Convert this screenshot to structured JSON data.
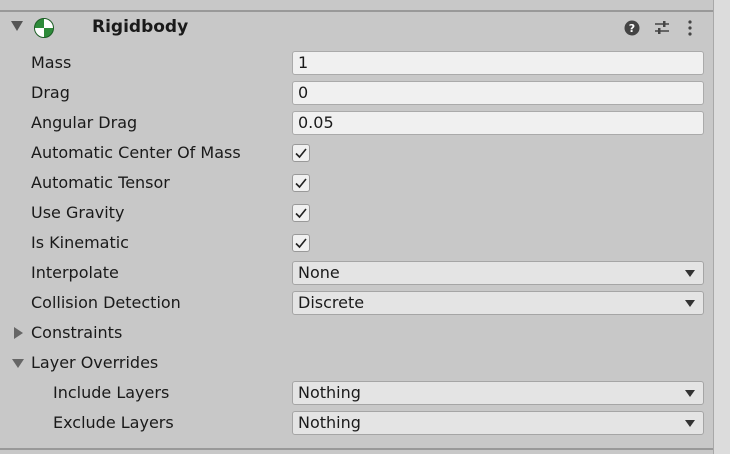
{
  "component": {
    "title": "Rigidbody",
    "icon": "rigidbody-icon",
    "tools": [
      "help-icon",
      "presets-icon",
      "more-options-icon"
    ]
  },
  "fields": {
    "mass": {
      "label": "Mass",
      "value": "1"
    },
    "drag": {
      "label": "Drag",
      "value": "0"
    },
    "angular_drag": {
      "label": "Angular Drag",
      "value": "0.05"
    },
    "automatic_center_of_mass": {
      "label": "Automatic Center Of Mass",
      "checked": true
    },
    "automatic_tensor": {
      "label": "Automatic Tensor",
      "checked": true
    },
    "use_gravity": {
      "label": "Use Gravity",
      "checked": true
    },
    "is_kinematic": {
      "label": "Is Kinematic",
      "checked": true
    },
    "interpolate": {
      "label": "Interpolate",
      "value": "None"
    },
    "collision_detection": {
      "label": "Collision Detection",
      "value": "Discrete"
    },
    "constraints": {
      "label": "Constraints",
      "expanded": false
    },
    "layer_overrides": {
      "label": "Layer Overrides",
      "expanded": true,
      "include_layers": {
        "label": "Include Layers",
        "value": "Nothing"
      },
      "exclude_layers": {
        "label": "Exclude Layers",
        "value": "Nothing"
      }
    }
  },
  "colors": {
    "background": "#c8c8c8",
    "field": "#f0f0f0",
    "dropdown": "#e4e4e4",
    "icon_green": "#2e8b3a"
  }
}
